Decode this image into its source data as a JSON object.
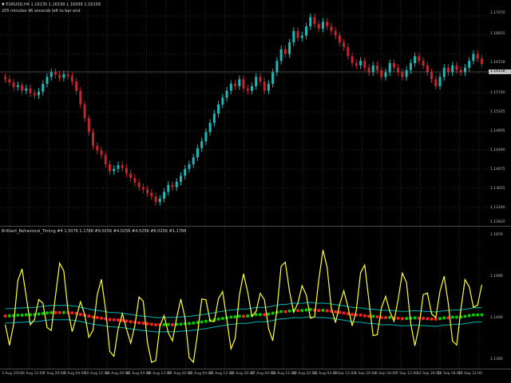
{
  "header": {
    "symbol_line": "▼ EURUSD,H4 1.16135 1.16199 1.16099 1.16158",
    "countdown": "205 minutes 46 seconds left to bar end"
  },
  "indicator": {
    "title": "Brilliant_Behavioral_Timing #4 1.5076 1.1788 #9.0256 #4.0256 #4.0256 #6.0256 #1.1788"
  },
  "price_scale": {
    "labels": [
      "1.17070",
      "1.16655",
      "1.16158",
      "1.15740",
      "1.15325",
      "1.14905",
      "1.14490",
      "1.14075",
      "1.13655",
      "1.13240",
      "1.12820"
    ],
    "current_price": "1.16158"
  },
  "indicator_scale": {
    "labels": [
      "1.1870",
      "1.1680",
      "1.1490",
      "1.1300"
    ]
  },
  "time_axis": {
    "labels": [
      "3 Aug 2018",
      "6 Aug 12:00",
      "7 Aug 20:00",
      "9 Aug 04:00",
      "10 Aug 12:00",
      "13 Aug 20:00",
      "15 Aug 04:00",
      "16 Aug 12:00",
      "17 Aug 20:00",
      "21 Aug 04:00",
      "22 Aug 12:00",
      "23 Aug 20:00",
      "27 Aug 04:00",
      "28 Aug 12:00",
      "29 Aug 20:00",
      "31 Aug 04:00",
      "3 Sep 12:00",
      "4 Sep 20:00",
      "6 Sep 04:00",
      "7 Sep 12:00",
      "10 Sep 20:00",
      "12 Sep 04:00",
      "13 Sep 12:00"
    ]
  },
  "chart_data": {
    "type": "candlestick",
    "colors": {
      "up": "#1fb7b7",
      "down": "#c0272d",
      "oscillator": "#ffff33",
      "band": "#00b3b3",
      "dot_up": "#00cc00",
      "dot_down": "#ff2020"
    },
    "closes": [
      1.1585,
      1.1578,
      1.1568,
      1.1572,
      1.156,
      1.1565,
      1.1555,
      1.155,
      1.1558,
      1.1575,
      1.159,
      1.16,
      1.1595,
      1.1588,
      1.1596,
      1.1592,
      1.158,
      1.156,
      1.153,
      1.15,
      1.147,
      1.144,
      1.143,
      1.142,
      1.14,
      1.1385,
      1.139,
      1.1398,
      1.1392,
      1.138,
      1.137,
      1.136,
      1.135,
      1.1345,
      1.1338,
      1.133,
      1.1318,
      1.1325,
      1.134,
      1.1355,
      1.135,
      1.1362,
      1.1375,
      1.139,
      1.14,
      1.1415,
      1.1435,
      1.145,
      1.147,
      1.149,
      1.151,
      1.153,
      1.1545,
      1.156,
      1.1575,
      1.157,
      1.1585,
      1.1565,
      1.156,
      1.157,
      1.159,
      1.158,
      1.156,
      1.1575,
      1.16,
      1.1625,
      1.165,
      1.164,
      1.1665,
      1.169,
      1.1675,
      1.168,
      1.17,
      1.172,
      1.1705,
      1.1695,
      1.171,
      1.17,
      1.169,
      1.168,
      1.1665,
      1.1655,
      1.1635,
      1.162,
      1.1615,
      1.1625,
      1.161,
      1.16,
      1.1615,
      1.1605,
      1.159,
      1.16,
      1.162,
      1.161,
      1.16,
      1.159,
      1.1605,
      1.162,
      1.1635,
      1.1625,
      1.1615,
      1.16,
      1.1585,
      1.157,
      1.159,
      1.161,
      1.16,
      1.1615,
      1.1605,
      1.16,
      1.161,
      1.1625,
      1.164,
      1.163,
      1.1618
    ]
  }
}
